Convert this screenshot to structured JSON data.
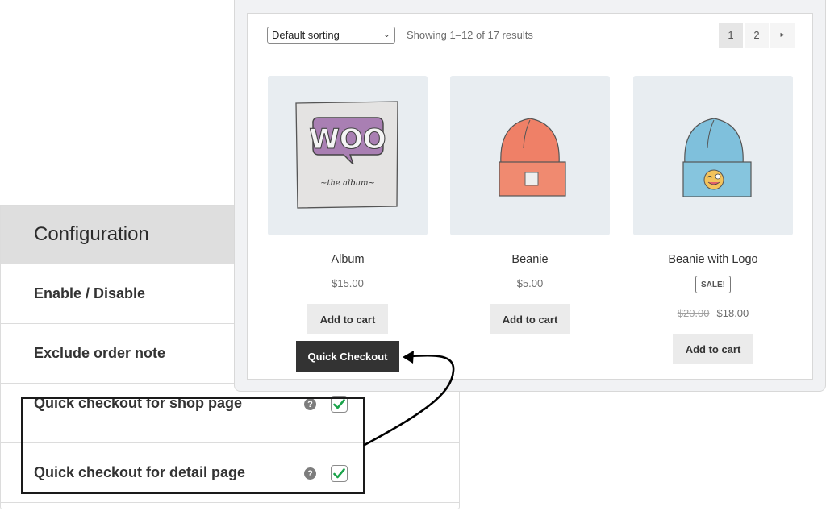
{
  "config": {
    "title": "Configuration",
    "rows": [
      {
        "label": "Enable / Disable"
      },
      {
        "label": "Exclude order note"
      },
      {
        "label": "Quick checkout for shop page",
        "help": "?",
        "checked": true
      },
      {
        "label": "Quick checkout for detail page",
        "help": "?",
        "checked": true
      }
    ]
  },
  "shop": {
    "sorting": {
      "selected": "Default sorting"
    },
    "result_count": "Showing 1–12 of 17 results",
    "pagination": {
      "pages": [
        "1",
        "2"
      ],
      "current": "1",
      "next": "▸"
    },
    "products": [
      {
        "name": "Album",
        "price": "$15.00",
        "add_to_cart": "Add to cart",
        "quick_checkout": "Quick Checkout",
        "image": "woo-album-art"
      },
      {
        "name": "Beanie",
        "price": "$5.00",
        "add_to_cart": "Add to cart",
        "image": "orange-beanie"
      },
      {
        "name": "Beanie with Logo",
        "sale_badge": "SALE!",
        "regular_price": "$20.00",
        "sale_price": "$18.00",
        "add_to_cart": "Add to cart",
        "image": "blue-beanie-with-emoji"
      }
    ]
  },
  "colors": {
    "check": "#1aa34a",
    "quick_checkout_bg": "#333333",
    "config_header_bg": "#dedede"
  }
}
